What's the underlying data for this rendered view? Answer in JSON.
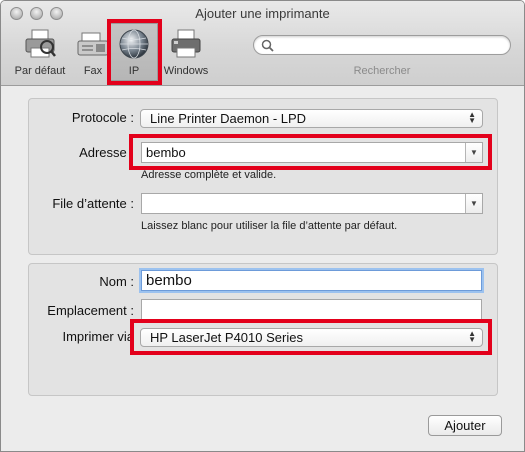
{
  "window": {
    "title": "Ajouter une imprimante"
  },
  "toolbar": {
    "items": [
      {
        "label": "Par défaut",
        "icon": "printer-default-icon"
      },
      {
        "label": "Fax",
        "icon": "fax-icon"
      },
      {
        "label": "IP",
        "icon": "globe-icon"
      },
      {
        "label": "Windows",
        "icon": "windows-printer-icon"
      }
    ],
    "search": {
      "placeholder": "",
      "label": "Rechercher"
    }
  },
  "connection": {
    "protocol": {
      "label": "Protocole :",
      "value": "Line Printer Daemon - LPD"
    },
    "address": {
      "label": "Adresse :",
      "value": "bembo",
      "hint": "Adresse complète et valide."
    },
    "queue": {
      "label": "File d’attente :",
      "value": "",
      "hint": "Laissez blanc pour utiliser la file d’attente par défaut."
    }
  },
  "details": {
    "name": {
      "label": "Nom :",
      "value": "bembo"
    },
    "location": {
      "label": "Emplacement :",
      "value": ""
    },
    "driver": {
      "label": "Imprimer via",
      "value": "HP LaserJet P4010 Series"
    }
  },
  "actions": {
    "add_label": "Ajouter"
  },
  "colors": {
    "highlight": "#e3001b",
    "focus": "#9cc2ef"
  }
}
